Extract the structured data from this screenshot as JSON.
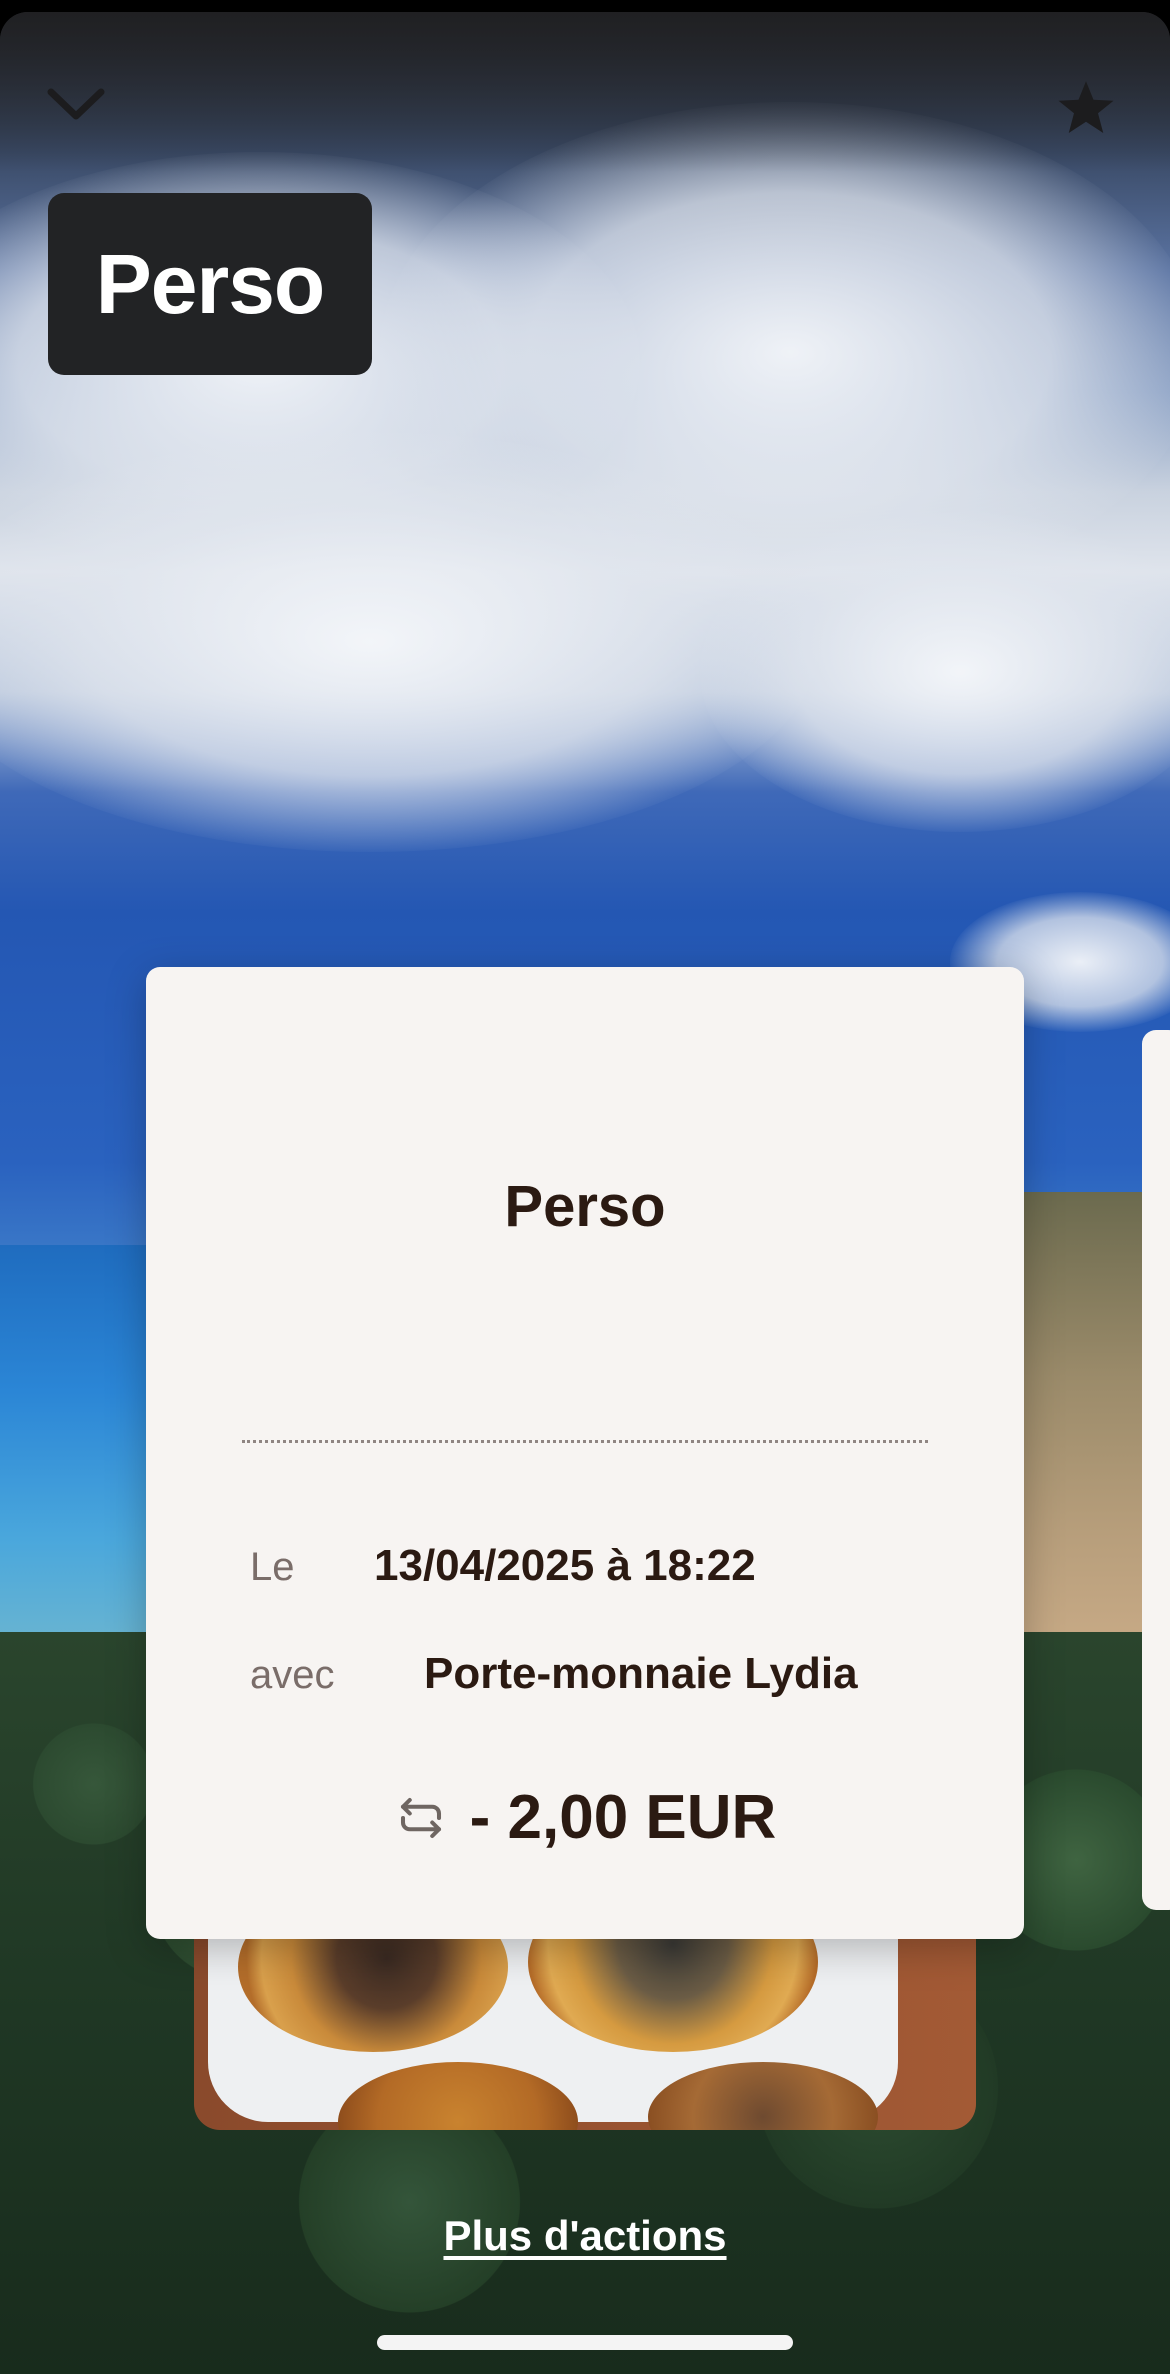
{
  "header": {
    "collapse_icon": "chevron-down-icon",
    "favorite_icon": "star-icon",
    "account_chip": "Perso"
  },
  "receipt": {
    "title": "Perso",
    "date_label": "Le",
    "date_value": "13/04/2025 à 18:22",
    "with_label": "avec",
    "with_value": "Porte-monnaie Lydia",
    "recurrence_icon": "repeat-icon",
    "amount": "- 2,00 EUR"
  },
  "footer": {
    "more_actions": "Plus d'actions"
  },
  "colors": {
    "card_background": "#f7f4f2",
    "text_dark": "#2b1a12",
    "text_muted": "#7a6d69",
    "chip_background": "#222325"
  }
}
